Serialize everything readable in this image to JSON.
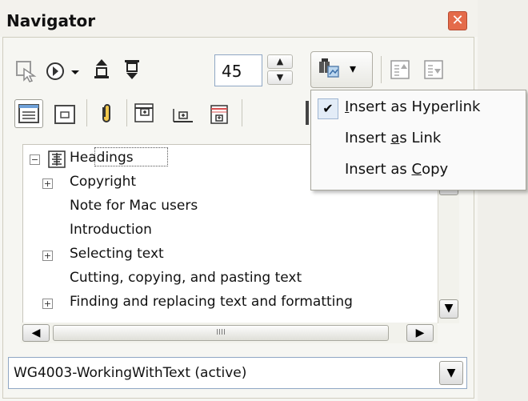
{
  "window": {
    "title": "Navigator",
    "close_label": "✕"
  },
  "toolbar": {
    "spin_value": "45",
    "spin_up": "▲",
    "spin_down": "▼",
    "dropdown_arrow": "▾",
    "icons": [
      "toggle-icon",
      "navigation-icon",
      "previous-icon",
      "next-icon",
      "drag-mode-icon",
      "promote-chapter-icon",
      "demote-chapter-icon",
      "content-view-icon",
      "set-reminder-icon",
      "header-icon",
      "footer-icon",
      "anchor-icon",
      "promote-level-icon",
      "demote-level-icon"
    ]
  },
  "dropdown_menu": {
    "items": [
      {
        "label": "Insert as Hyperlink",
        "checked": true,
        "accel": "I"
      },
      {
        "label": "Insert as Link",
        "checked": false,
        "accel": "a"
      },
      {
        "label": "Insert as Copy",
        "checked": false,
        "accel": "C"
      }
    ],
    "check_glyph": "✔"
  },
  "tree": {
    "root": {
      "label": "Headings",
      "expander": "−"
    },
    "items": [
      {
        "label": "Copyright",
        "expandable": true
      },
      {
        "label": "Note for Mac users",
        "expandable": false
      },
      {
        "label": "Introduction",
        "expandable": false
      },
      {
        "label": "Selecting text",
        "expandable": true
      },
      {
        "label": "Cutting, copying, and pasting text",
        "expandable": false
      },
      {
        "label": "Finding and replacing text and formatting",
        "expandable": true
      }
    ],
    "expand_glyph": "+"
  },
  "scrollbars": {
    "up": "▲",
    "down": "▼",
    "left": "◀",
    "right": "▶",
    "grip": "IIII"
  },
  "document_selector": {
    "value": "WG4003-WorkingWithText (active)",
    "arrow": "▼"
  },
  "colors": {
    "close": "#e46b4a",
    "menu_check_bg": "#e3ecf7"
  }
}
